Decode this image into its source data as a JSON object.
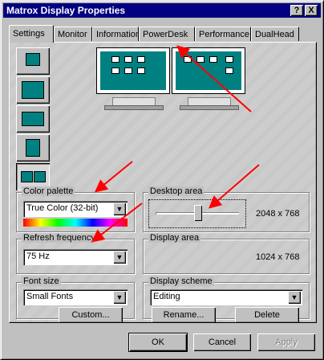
{
  "window": {
    "title": "Matrox Display Properties"
  },
  "titlebar_buttons": {
    "help": "?",
    "close": "X"
  },
  "tabs": [
    {
      "label": "Settings",
      "active": true
    },
    {
      "label": "Monitor",
      "active": false
    },
    {
      "label": "Information",
      "active": false
    },
    {
      "label": "PowerDesk",
      "active": false
    },
    {
      "label": "Performance",
      "active": false
    },
    {
      "label": "DualHead",
      "active": false
    }
  ],
  "color_palette": {
    "label": "Color palette",
    "value": "True Color (32-bit)"
  },
  "desktop_area": {
    "label": "Desktop area",
    "value": "2048 x 768",
    "slider_level": 0.5
  },
  "refresh_frequency": {
    "label": "Refresh frequency",
    "value": "75 Hz"
  },
  "display_area": {
    "label": "Display area",
    "value": "1024 x 768"
  },
  "font_size": {
    "label": "Font size",
    "value": "Small Fonts",
    "custom_button": "Custom..."
  },
  "display_scheme": {
    "label": "Display scheme",
    "value": "Editing",
    "rename_button": "Rename...",
    "delete_button": "Delete"
  },
  "footer": {
    "ok": "OK",
    "cancel": "Cancel",
    "apply": "Apply"
  },
  "colors": {
    "titlebar": "#000080",
    "dialog": "#c0c0c0",
    "annotation_arrow": "#ff0000",
    "desktop": "#008080"
  }
}
